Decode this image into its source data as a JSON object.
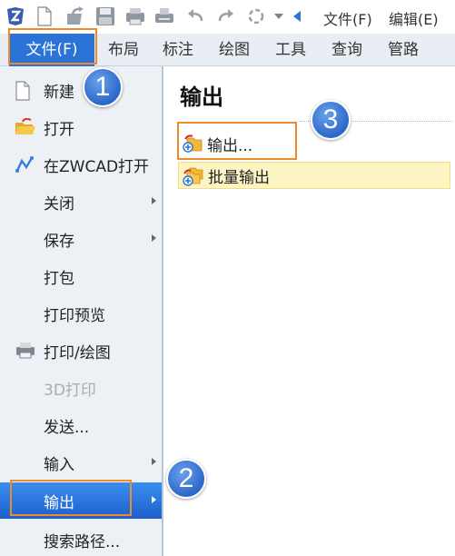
{
  "toolbar": {
    "menu_items": [
      "文件(F)",
      "编辑(E)"
    ],
    "icons": [
      "app-logo-icon",
      "new-file-icon",
      "open-icon",
      "save-icon",
      "print-icon",
      "plot-icon",
      "undo-icon",
      "redo-icon",
      "workspace-icon",
      "dropdown-icon",
      "back-arrow-icon"
    ]
  },
  "ribbon": {
    "tabs": [
      "文件(F)",
      "布局",
      "标注",
      "绘图",
      "工具",
      "查询",
      "管路"
    ],
    "active_tab": "文件(F)"
  },
  "file_menu": {
    "items": [
      {
        "label": "新建",
        "icon": "new-document-icon",
        "submenu": false,
        "disabled": false
      },
      {
        "label": "打开",
        "icon": "open-folder-icon",
        "submenu": false,
        "disabled": false
      },
      {
        "label": "在ZWCAD打开",
        "icon": "zwcad-icon",
        "submenu": false,
        "disabled": false
      },
      {
        "label": "关闭",
        "icon": "",
        "submenu": true,
        "disabled": false
      },
      {
        "label": "保存",
        "icon": "",
        "submenu": true,
        "disabled": false
      },
      {
        "label": "打包",
        "icon": "",
        "submenu": false,
        "disabled": false
      },
      {
        "label": "打印预览",
        "icon": "",
        "submenu": false,
        "disabled": false
      },
      {
        "label": "打印/绘图",
        "icon": "printer-icon",
        "submenu": false,
        "disabled": false
      },
      {
        "label": "3D打印",
        "icon": "",
        "submenu": false,
        "disabled": true
      },
      {
        "label": "发送...",
        "icon": "",
        "submenu": false,
        "disabled": false
      },
      {
        "label": "输入",
        "icon": "",
        "submenu": true,
        "disabled": false
      },
      {
        "label": "输出",
        "icon": "",
        "submenu": true,
        "disabled": false,
        "selected": true
      },
      {
        "label": "搜索路径...",
        "icon": "",
        "submenu": false,
        "disabled": false
      }
    ]
  },
  "export_pane": {
    "title": "输出",
    "items": [
      {
        "label": "输出...",
        "icon": "export-icon",
        "highlighted": false
      },
      {
        "label": "批量输出",
        "icon": "batch-export-icon",
        "highlighted": true
      }
    ]
  },
  "annotations": {
    "badges": [
      "1",
      "2",
      "3"
    ],
    "box_color": "#f08a2a",
    "badge_color": "#2c67c9"
  },
  "colors": {
    "active_tab": "#2b73d6",
    "selected_item": "#1d5fcc",
    "highlight": "#fdf4c4"
  }
}
